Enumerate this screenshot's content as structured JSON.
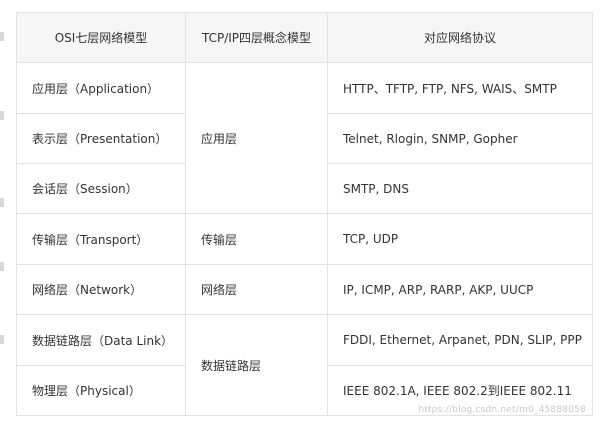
{
  "table": {
    "headers": [
      "OSI七层网络模型",
      "TCP/IP四层概念模型",
      "对应网络协议"
    ],
    "tcpip_layers": [
      "应用层",
      "传输层",
      "网络层",
      "数据链路层"
    ],
    "rows": [
      {
        "osi": "应用层（Application）",
        "protocols": "HTTP、TFTP, FTP, NFS, WAIS、SMTP"
      },
      {
        "osi": "表示层（Presentation）",
        "protocols": "Telnet, Rlogin, SNMP, Gopher"
      },
      {
        "osi": "会话层（Session）",
        "protocols": "SMTP, DNS"
      },
      {
        "osi": "传输层（Transport）",
        "protocols": "TCP, UDP"
      },
      {
        "osi": "网络层（Network）",
        "protocols": "IP, ICMP, ARP, RARP, AKP, UUCP"
      },
      {
        "osi": "数据链路层（Data Link）",
        "protocols": "FDDI, Ethernet, Arpanet, PDN, SLIP, PPP"
      },
      {
        "osi": "物理层（Physical）",
        "protocols": "IEEE 802.1A, IEEE 802.2到IEEE 802.11"
      }
    ]
  },
  "watermark": "https://blog.csdn.net/m0_45888058"
}
